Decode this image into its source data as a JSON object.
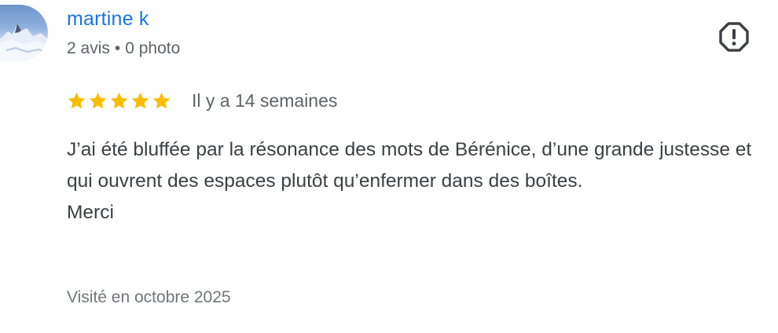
{
  "author": {
    "name": "martine k",
    "reviews_count": "2 avis",
    "separator": "•",
    "photos_count": "0 photo"
  },
  "review": {
    "rating": 5,
    "rating_max": 5,
    "relative_date": "Il y a 14 semaines",
    "text_line_1": "J’ai été bluffée par la résonance des mots de Bérénice, d’une grande justesse et qui ouvrent des espaces plutôt qu’enfermer dans des boîtes.",
    "text_line_2": "Merci",
    "visited": "Visité en octobre 2025"
  },
  "icons": {
    "flag": "report-octagon-icon",
    "star": "star-icon"
  },
  "colors": {
    "author_link": "#1a73e8",
    "star": "#fbbc04",
    "meta_text": "#5f6368",
    "body_text": "#3c4043"
  }
}
